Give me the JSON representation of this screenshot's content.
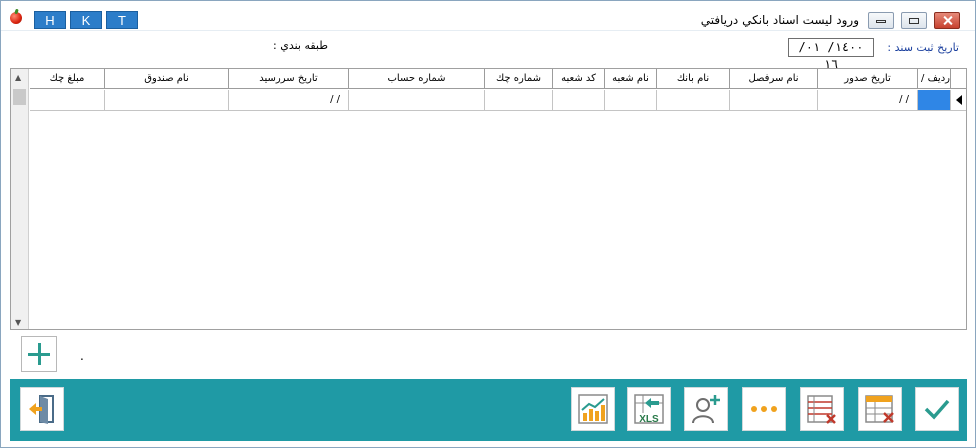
{
  "window": {
    "title": "ورود ليست اسناد بانكي دريافتي",
    "hkt_buttons": [
      "H",
      "K",
      "T"
    ]
  },
  "form": {
    "date_label": "تاريخ ثبت سند :",
    "date_value": "١٤٠٠/ ٠١/ ١٦",
    "category_label": "طبقه بندي :"
  },
  "grid": {
    "columns": [
      "رديف / نمره",
      "تاريخ صدور",
      "نام سرفصل",
      "نام بانك",
      "نام شعبه",
      "كد شعبه",
      "شماره چك",
      "شماره حساب",
      "تاريخ سررسيد",
      "نام صندوق",
      "مبلغ چك"
    ],
    "rows": [
      {
        "issue_date": "/  /",
        "due_date": "/  /"
      }
    ]
  },
  "footer": {
    "total_value": "."
  },
  "toolbar": {
    "icons": [
      "exit-icon",
      "chart-report-icon",
      "excel-import-icon",
      "add-person-icon",
      "more-icon",
      "delete-rows-icon",
      "clear-table-icon",
      "confirm-icon"
    ]
  },
  "colors": {
    "accent": "#1f9aa5",
    "selection": "#2f86e6",
    "hkt": "#2c7dc9"
  }
}
